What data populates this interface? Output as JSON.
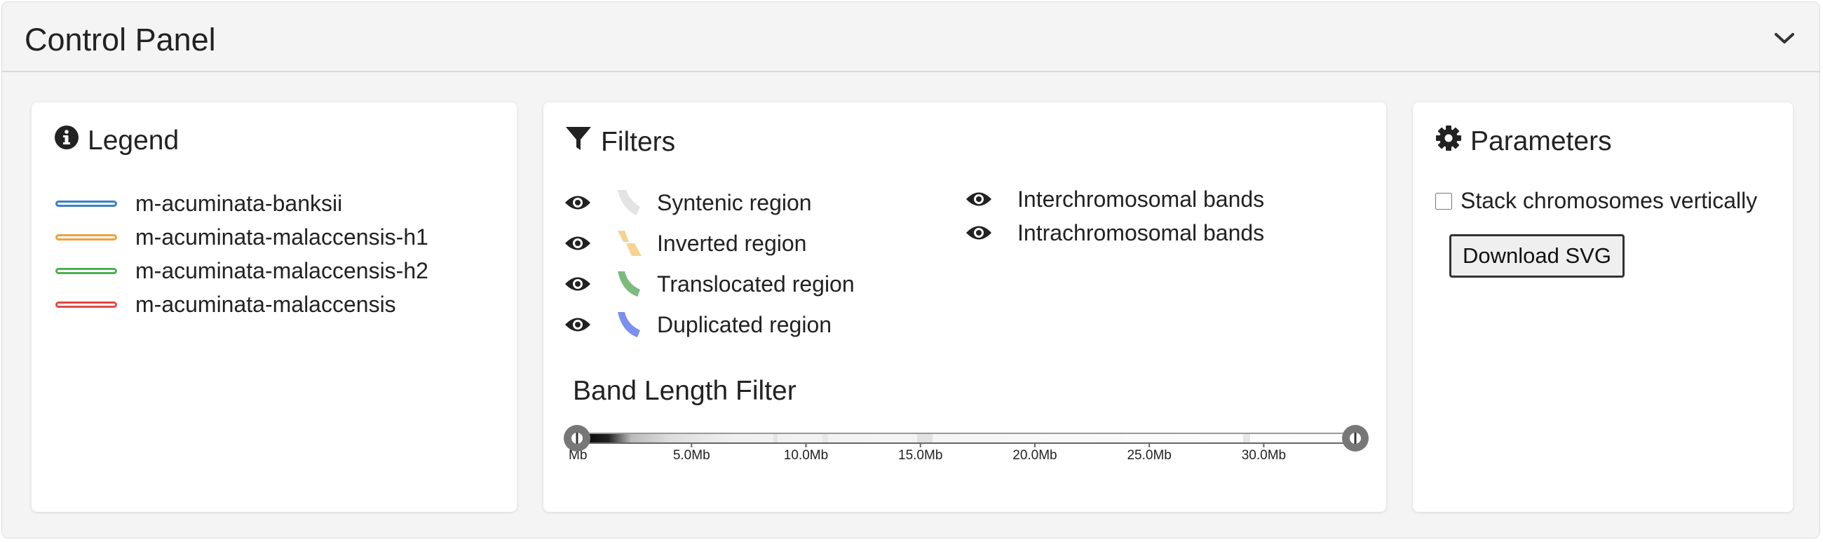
{
  "panel": {
    "title": "Control Panel"
  },
  "legend": {
    "title": "Legend",
    "items": [
      {
        "label": "m-acuminata-banksii",
        "color": "#3a80c4"
      },
      {
        "label": "m-acuminata-malaccensis-h1",
        "color": "#f0a13d"
      },
      {
        "label": "m-acuminata-malaccensis-h2",
        "color": "#4caf50"
      },
      {
        "label": "m-acuminata-malaccensis",
        "color": "#e04b45"
      }
    ]
  },
  "filters": {
    "title": "Filters",
    "region_items": [
      {
        "label": "Syntenic region",
        "color": "#e3e3e3"
      },
      {
        "label": "Inverted region",
        "color": "#f6d38f"
      },
      {
        "label": "Translocated region",
        "color": "#7dba7d"
      },
      {
        "label": "Duplicated region",
        "color": "#7b8ff0"
      }
    ],
    "band_items": [
      {
        "label": "Interchromosomal bands"
      },
      {
        "label": "Intrachromosomal bands"
      }
    ],
    "band_length_title": "Band Length Filter",
    "slider": {
      "min_label": "Mb",
      "ticks": [
        "5.0Mb",
        "10.0Mb",
        "15.0Mb",
        "20.0Mb",
        "25.0Mb",
        "30.0Mb"
      ],
      "range_min_mb": 0,
      "range_max_mb": 34,
      "selected_low_mb": 0,
      "selected_high_mb": 34
    }
  },
  "parameters": {
    "title": "Parameters",
    "stack_label": "Stack chromosomes vertically",
    "stack_checked": false,
    "download_label": "Download SVG"
  }
}
